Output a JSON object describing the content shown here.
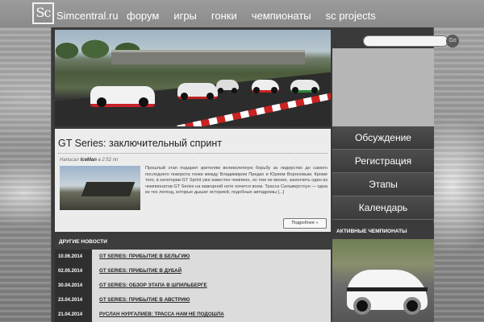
{
  "site": {
    "logo_text": "Sc",
    "name": "Simcentral.ru"
  },
  "nav": [
    "форум",
    "игры",
    "гонки",
    "чемпионаты",
    "sc projects"
  ],
  "search": {
    "button_label": "Go"
  },
  "right_menu": [
    "Обсуждение",
    "Регистрация",
    "Этапы",
    "Календарь"
  ],
  "sidebar": {
    "champ_heading": "АКТИВНЫЕ ЧЕМПИОНАТЫ"
  },
  "article": {
    "title": "GT Series: заключительный спринт",
    "meta_prefix": "Написал",
    "author": "IceMan",
    "time": "в 2:52 пп",
    "text": "Прошлый этап подарил зрителям великолепную борьбу за лидерство до самого последнего поворота гонки между Владимиром Предко и Юрием Вороновым. Кроме того, в категории GT Sprint уже известен чемпион, но тем не менее, закончить один из чемпионатов GT Series на мажорной ноте хочется всем. Трасса Сильверстоун — одна из тех легенд, которые дышат историей, подобные автодромы [...]",
    "more_label": "Подробнее »"
  },
  "news": {
    "heading": "ДРУГИЕ НОВОСТИ",
    "items": [
      {
        "date": "10.06.2014",
        "title": "GT SERIES: ПРИБЫТИЕ В БЕЛЬГИЮ"
      },
      {
        "date": "02.05.2014",
        "title": "GT SERIES: ПРИБЫТИЕ В ДУБАЙ"
      },
      {
        "date": "30.04.2014",
        "title": "GT SERIES: ОБЗОР ЭТАПА В ШПИЛЬБЕРГЕ"
      },
      {
        "date": "23.04.2014",
        "title": "GT SERIES: ПРИБЫТИЕ В АВСТРИЮ"
      },
      {
        "date": "21.04.2014",
        "title": "РУСЛАН НУРГАЛИЕВ: ТРАССА НАМ НЕ ПОДОШЛА"
      }
    ]
  }
}
